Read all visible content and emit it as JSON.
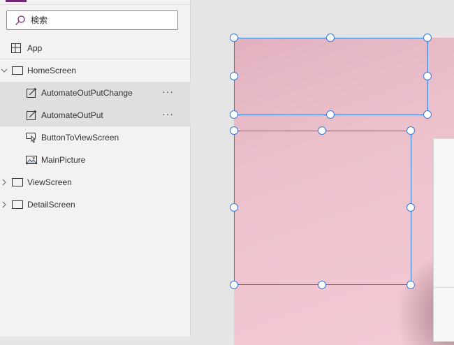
{
  "search": {
    "placeholder": "検索"
  },
  "tree": {
    "app": {
      "label": "App"
    },
    "home_screen": {
      "label": "HomeScreen",
      "expanded": true
    },
    "children": [
      {
        "label": "AutomateOutPutChange",
        "icon": "text-input-icon",
        "selected": true,
        "more": "···"
      },
      {
        "label": "AutomateOutPut",
        "icon": "text-input-icon",
        "selected": true,
        "more": "···"
      },
      {
        "label": "ButtonToViewScreen",
        "icon": "button-icon"
      },
      {
        "label": "MainPicture",
        "icon": "image-icon"
      }
    ],
    "view_screen": {
      "label": "ViewScreen",
      "expanded": false
    },
    "detail_screen": {
      "label": "DetailScreen",
      "expanded": false
    }
  },
  "colors": {
    "accent": "#742774",
    "selection": "#2f7ad6",
    "canvas_background": "#f0c5d0"
  }
}
